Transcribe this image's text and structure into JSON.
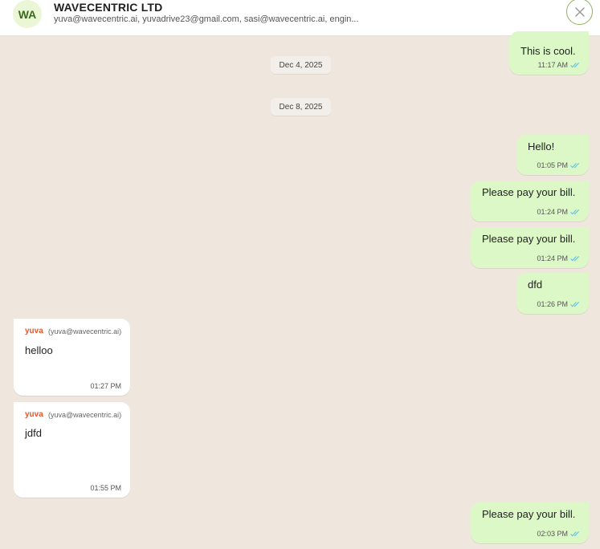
{
  "header": {
    "avatar_initials": "WA",
    "title": "WAVECENTRIC LTD",
    "participants": "yuva@wavecentric.ai, yuvadrive23@gmail.com, sasi@wavecentric.ai, engin...",
    "close_icon": "close-icon"
  },
  "colors": {
    "chat_background": "#efe7de",
    "outgoing_bubble": "#dcf8c6",
    "incoming_bubble": "#ffffff",
    "sender_name": "#e0572d",
    "read_ticks": "#53bdeb"
  },
  "chat": {
    "dates": [
      "Dec 4, 2025",
      "Dec 8, 2025"
    ],
    "messages": [
      {
        "direction": "out",
        "text": "This is cool.",
        "time": "11:17 AM",
        "status": "read"
      },
      {
        "direction": "out",
        "text": "Hello!",
        "time": "01:05 PM",
        "status": "read"
      },
      {
        "direction": "out",
        "text": "Please pay your bill.",
        "time": "01:24 PM",
        "status": "read"
      },
      {
        "direction": "out",
        "text": "Please pay your bill.",
        "time": "01:24 PM",
        "status": "read"
      },
      {
        "direction": "out",
        "text": "dfd",
        "time": "01:26 PM",
        "status": "read"
      },
      {
        "direction": "in",
        "sender": "yuva",
        "email": "(yuva@wavecentric.ai)",
        "text": "helloo",
        "time": "01:27 PM"
      },
      {
        "direction": "in",
        "sender": "yuva",
        "email": "(yuva@wavecentric.ai)",
        "text": "jdfd",
        "time": "01:55 PM"
      },
      {
        "direction": "out",
        "text": "Please pay your bill.",
        "time": "02:03 PM",
        "status": "read"
      }
    ]
  }
}
